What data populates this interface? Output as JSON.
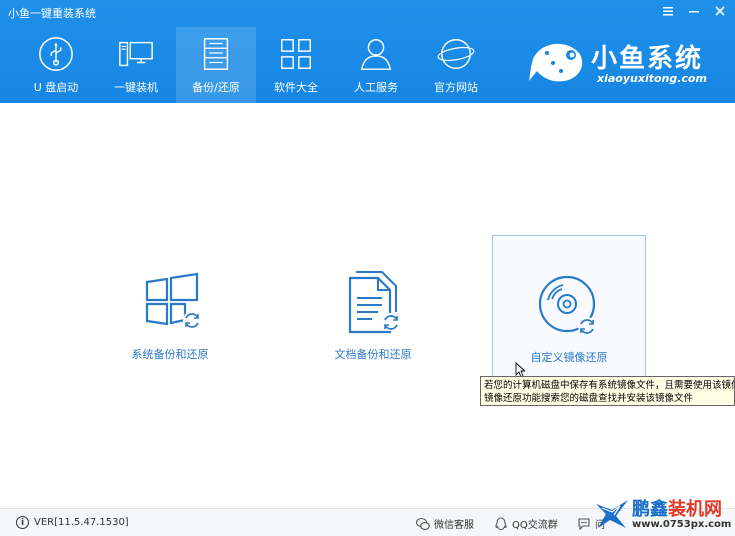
{
  "window": {
    "title": "小鱼一键重装系统",
    "controls": [
      "menu-icon",
      "minimize-icon",
      "close-icon"
    ]
  },
  "nav": {
    "items": [
      {
        "label": "U 盘启动",
        "icon": "usb-icon",
        "active": false
      },
      {
        "label": "一键装机",
        "icon": "computer-icon",
        "active": false
      },
      {
        "label": "备份/还原",
        "icon": "backup-icon",
        "active": true
      },
      {
        "label": "软件大全",
        "icon": "apps-grid-icon",
        "active": false
      },
      {
        "label": "人工服务",
        "icon": "person-icon",
        "active": false
      },
      {
        "label": "官方网站",
        "icon": "globe-icon",
        "active": false
      }
    ]
  },
  "logo": {
    "text": "小鱼系统",
    "sub": "xiaoyuxitong.com"
  },
  "options": [
    {
      "label": "系统备份和还原",
      "icon": "windows-restore-icon"
    },
    {
      "label": "文档备份和还原",
      "icon": "document-restore-icon"
    },
    {
      "label": "自定义镜像还原",
      "icon": "disc-restore-icon"
    }
  ],
  "tooltip": {
    "line1": "若您的计算机磁盘中保存有系统镜像文件，且需要使用该镜像",
    "line2": "镜像还原功能搜索您的磁盘查找并安装该镜像文件"
  },
  "footer": {
    "version": "VER[11.5.47.1530]",
    "wechat": "微信客服",
    "qq": "QQ交流群",
    "feedback": "问"
  },
  "watermark": {
    "title_main": "鹏鑫",
    "title_accent": "装机网",
    "url": "www.0753px.com"
  },
  "colors": {
    "header_blue": "#1686e2",
    "link_blue": "#2a79c8"
  }
}
